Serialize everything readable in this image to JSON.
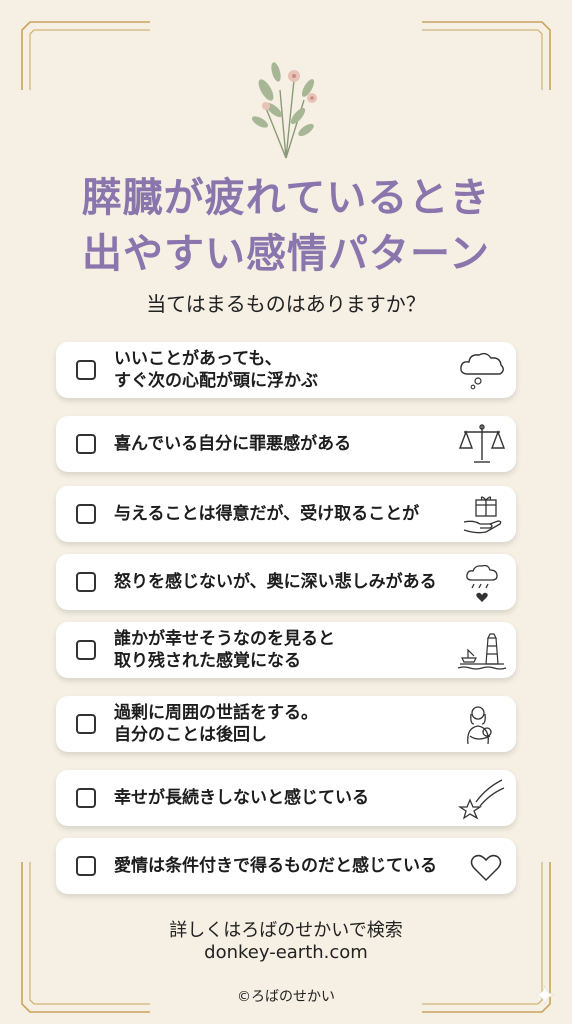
{
  "title_line1": "膵臓が疲れているとき",
  "title_line2": "出やすい感情パターン",
  "subtitle": "当てはまるものはありますか？",
  "items": [
    {
      "line1": "いいことがあっても、",
      "line2": "すぐ次の心配が頭に浮かぶ",
      "icon": "cloud-icon"
    },
    {
      "line1": "喜んでいる自分に罪悪感がある",
      "line2": "",
      "icon": "scale-icon"
    },
    {
      "line1": "与えることは得意だが、受け取ることが",
      "line2": "",
      "icon": "gift-hand-icon"
    },
    {
      "line1": "怒りを感じないが、奥に深い悲しみがある",
      "line2": "",
      "icon": "rain-heart-icon"
    },
    {
      "line1": "誰かが幸せそうなのを見ると",
      "line2": "取り残された感覚になる",
      "icon": "lighthouse-icon"
    },
    {
      "line1": "過剰に周囲の世話をする。",
      "line2": "自分のことは後回し",
      "icon": "mother-child-icon"
    },
    {
      "line1": "幸せが長続きしないと感じている",
      "line2": "",
      "icon": "shooting-star-icon"
    },
    {
      "line1": "愛情は条件付きで得るものだと感じている",
      "line2": "",
      "icon": "heart-icon"
    }
  ],
  "footer_line1": "詳しくはろばのせかいで検索",
  "footer_line2": "donkey-earth.com",
  "copyright": "©ろばのせかい",
  "colors": {
    "background": "#f6f0e4",
    "title": "#8a76ad",
    "gold": "#c9a45c"
  }
}
